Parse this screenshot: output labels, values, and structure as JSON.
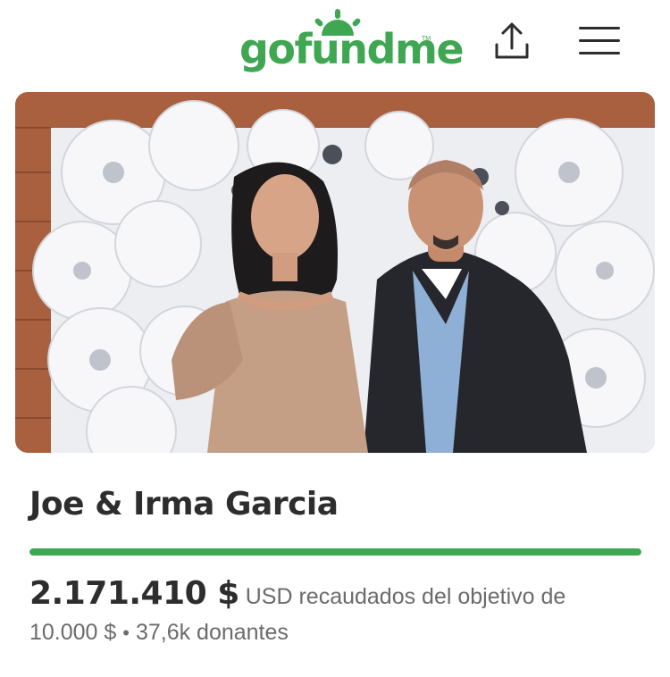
{
  "header": {
    "logo_text": "gofundme",
    "logo_tm": "TM",
    "share_icon": "share-upload-icon",
    "menu_icon": "hamburger-menu-icon",
    "brand_color": "#3fa652"
  },
  "campaign": {
    "title": "Joe & Irma Garcia",
    "photo": "couple-photo",
    "raised_amount": "2.171.410 $",
    "raised_text": "USD recaudados del objetivo de",
    "goal": "10.000 $",
    "separator": "•",
    "donors": "37,6k donantes",
    "progress_percent": 100
  }
}
